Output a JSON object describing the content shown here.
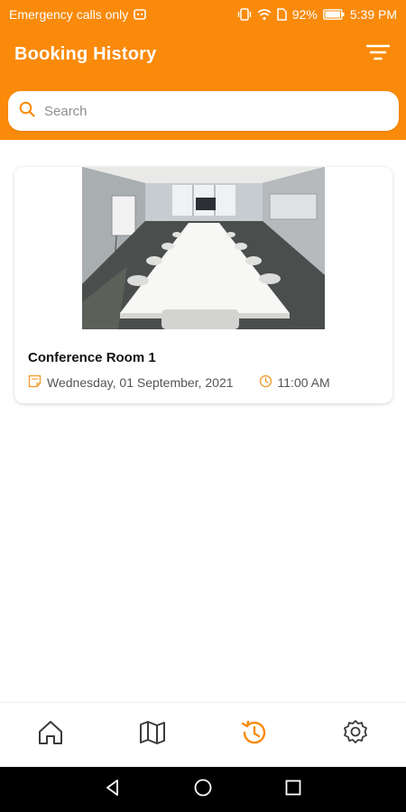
{
  "status_bar": {
    "carrier_text": "Emergency calls only",
    "battery": "92%",
    "time": "5:39 PM"
  },
  "header": {
    "title": "Booking History",
    "filter_icon": "filter-icon"
  },
  "search": {
    "placeholder": "Search",
    "value": ""
  },
  "bookings": [
    {
      "room": "Conference Room 1",
      "date": "Wednesday, 01 September, 2021",
      "time": "11:00 AM"
    }
  ],
  "bottom_nav": {
    "items": [
      {
        "icon": "home-icon",
        "active": false
      },
      {
        "icon": "map-icon",
        "active": false
      },
      {
        "icon": "history-icon",
        "active": true
      },
      {
        "icon": "settings-icon",
        "active": false
      }
    ]
  },
  "colors": {
    "accent": "#fa8a0a",
    "nav_inactive": "#3a3a3a",
    "card_icon": "#f0a23a"
  }
}
